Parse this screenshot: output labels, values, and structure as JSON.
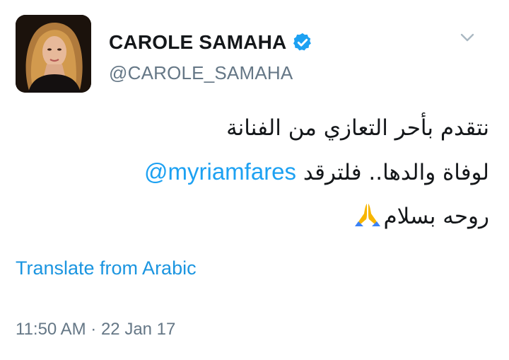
{
  "user": {
    "display_name": "CAROLE SAMAHA",
    "handle": "@CAROLE_SAMAHA",
    "verified": true,
    "avatar_icon": "profile-photo"
  },
  "tweet": {
    "line1": "نتقدم بأحر التعازي من الفنانة",
    "line2_mention": "@myriamfares",
    "line2_text": "لوفاة والدها.. فلترقد",
    "line3_text": "روحه بسلام",
    "emoji": "folded-hands-emoji"
  },
  "actions": {
    "translate_label": "Translate from Arabic",
    "menu_icon": "chevron-down-icon"
  },
  "meta": {
    "timestamp": "11:50 AM · 22 Jan 17"
  },
  "colors": {
    "text": "#14171a",
    "secondary": "#657786",
    "link": "#1da1f2",
    "verified": "#1da1f2"
  }
}
